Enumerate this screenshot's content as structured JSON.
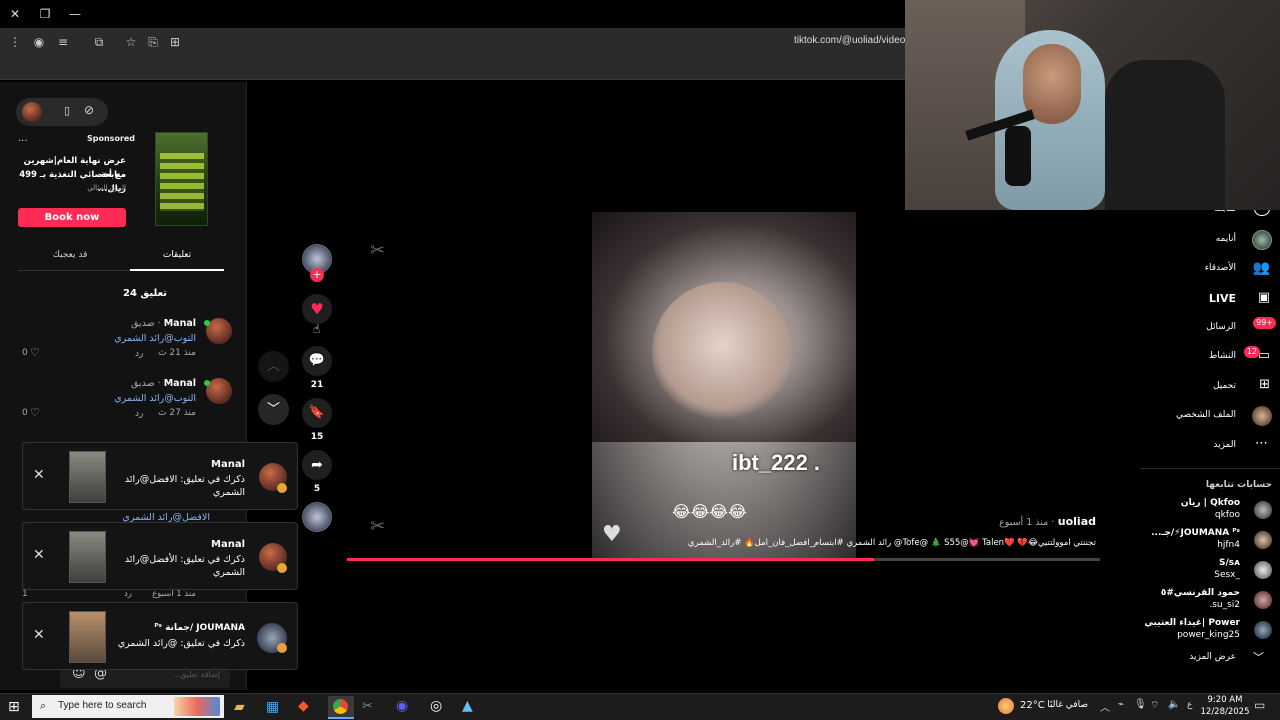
{
  "browser": {
    "url": "tiktok.com/@uoliad/video/"
  },
  "sponsored": {
    "label": "Sponsored",
    "more": "...",
    "ad_text_1": "عرض نهاية العام|شهرين متابعة",
    "ad_text_2": "مع أخصائي التغذية بـ 499 ريال...",
    "ad_brand": "الوزن المثالي",
    "cta": "Book now"
  },
  "comment_tabs": {
    "active": "تعليقات",
    "other": "قد يعجبك"
  },
  "comments": {
    "count_label": "24 تعليق",
    "items": [
      {
        "name": "Manal",
        "relation": "· صديق",
        "text": "التوب@رائد الشمري",
        "time": "منذ 21 ث",
        "reply": "رد",
        "likes": "0"
      },
      {
        "name": "Manal",
        "relation": "· صديق",
        "text": "التوب@رائد الشمري",
        "time": "منذ 27 ث",
        "reply": "رد",
        "likes": "0"
      }
    ],
    "partial_text": "الافضل@رائد الشمري",
    "partial_time": "منذ 1 أسبوع",
    "partial_reply": "رد",
    "partial_likes": "1",
    "input_placeholder": "إضافة تعليق...",
    "input_at": "@",
    "input_emoji": "☺"
  },
  "notifications": [
    {
      "name": "Manal",
      "text": "ذكرك في تعليق: الافضل@رائد الشمري"
    },
    {
      "name": "Manal",
      "text": "ذكرك في تعليق: الأفضل@رائد الشمري"
    },
    {
      "name": "JOUMANA /جمانة ᴾˢ",
      "text": "ذكرك في تعليق: @رائد الشمري"
    }
  ],
  "actions": {
    "likes": "",
    "comments": "21",
    "saves": "15",
    "shares": "5"
  },
  "video": {
    "overlay_text": "ibt_222 .",
    "emoji_row": "😂😂😂😂",
    "author": "uoliad",
    "time": "· منذ 1 أسبوع",
    "caption": "تجننتي اموولتتيي😂💔 ❤️Tofe@ 🎄 S55@💓 Talen@ رائد الشمري #ابتسام_افضل_فان_امل🔥 #رائد_الشمري",
    "progress": 0.7
  },
  "sidebar": {
    "items": [
      {
        "label": "متابعة",
        "icon": "follow-icon"
      },
      {
        "label": "أنايمه",
        "icon": "avatar-icon"
      },
      {
        "label": "الأصدقاء",
        "icon": "friends-icon"
      },
      {
        "label": "LIVE",
        "icon": "live-icon"
      },
      {
        "label": "الرسائل",
        "icon": "messages-icon",
        "badge": "99+"
      },
      {
        "label": "النشاط",
        "icon": "activity-icon",
        "badge": "12"
      },
      {
        "label": "تحميل",
        "icon": "upload-icon"
      },
      {
        "label": "الملف الشخصي",
        "icon": "profile-icon"
      },
      {
        "label": "المزيد",
        "icon": "more-icon"
      }
    ],
    "following_title": "حسابات تتابعها",
    "following": [
      {
        "name": "Qkfoo | ريان",
        "handle": "qkfoo"
      },
      {
        "name": "JOUMANA ᴾˢ⚡/جـ...",
        "handle": "hjfn4"
      },
      {
        "name": "S/ꜱᴀ",
        "handle": "_Sesx"
      },
      {
        "name": "حمود القرنسي#٥",
        "handle": "su_si2."
      },
      {
        "name": "Power |غيداء العتيبي",
        "handle": "power_king25"
      }
    ],
    "see_more": "عرض المزيد"
  },
  "taskbar": {
    "search_placeholder": "Type here to search",
    "weather": "22°C",
    "weather_desc": "صافي غالبًا",
    "lang": "ع",
    "time": "9:20 AM",
    "date": "12/28/2025"
  },
  "colors": {
    "accent": "#fe2c55",
    "link": "#8ab4f8"
  }
}
